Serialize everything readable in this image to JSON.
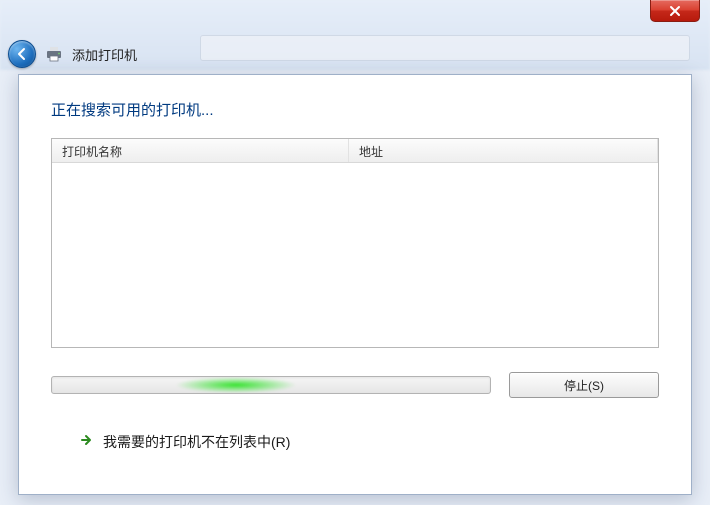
{
  "window": {
    "title": "添加打印机"
  },
  "main": {
    "searching_label": "正在搜索可用的打印机...",
    "columns": {
      "name": "打印机名称",
      "address": "地址"
    },
    "stop_button": "停止(S)",
    "not_in_list_link": "我需要的打印机不在列表中(R)"
  },
  "icons": {
    "back": "back-arrow-icon",
    "printer": "printer-icon",
    "close": "close-icon",
    "right_arrow": "right-arrow-icon"
  }
}
